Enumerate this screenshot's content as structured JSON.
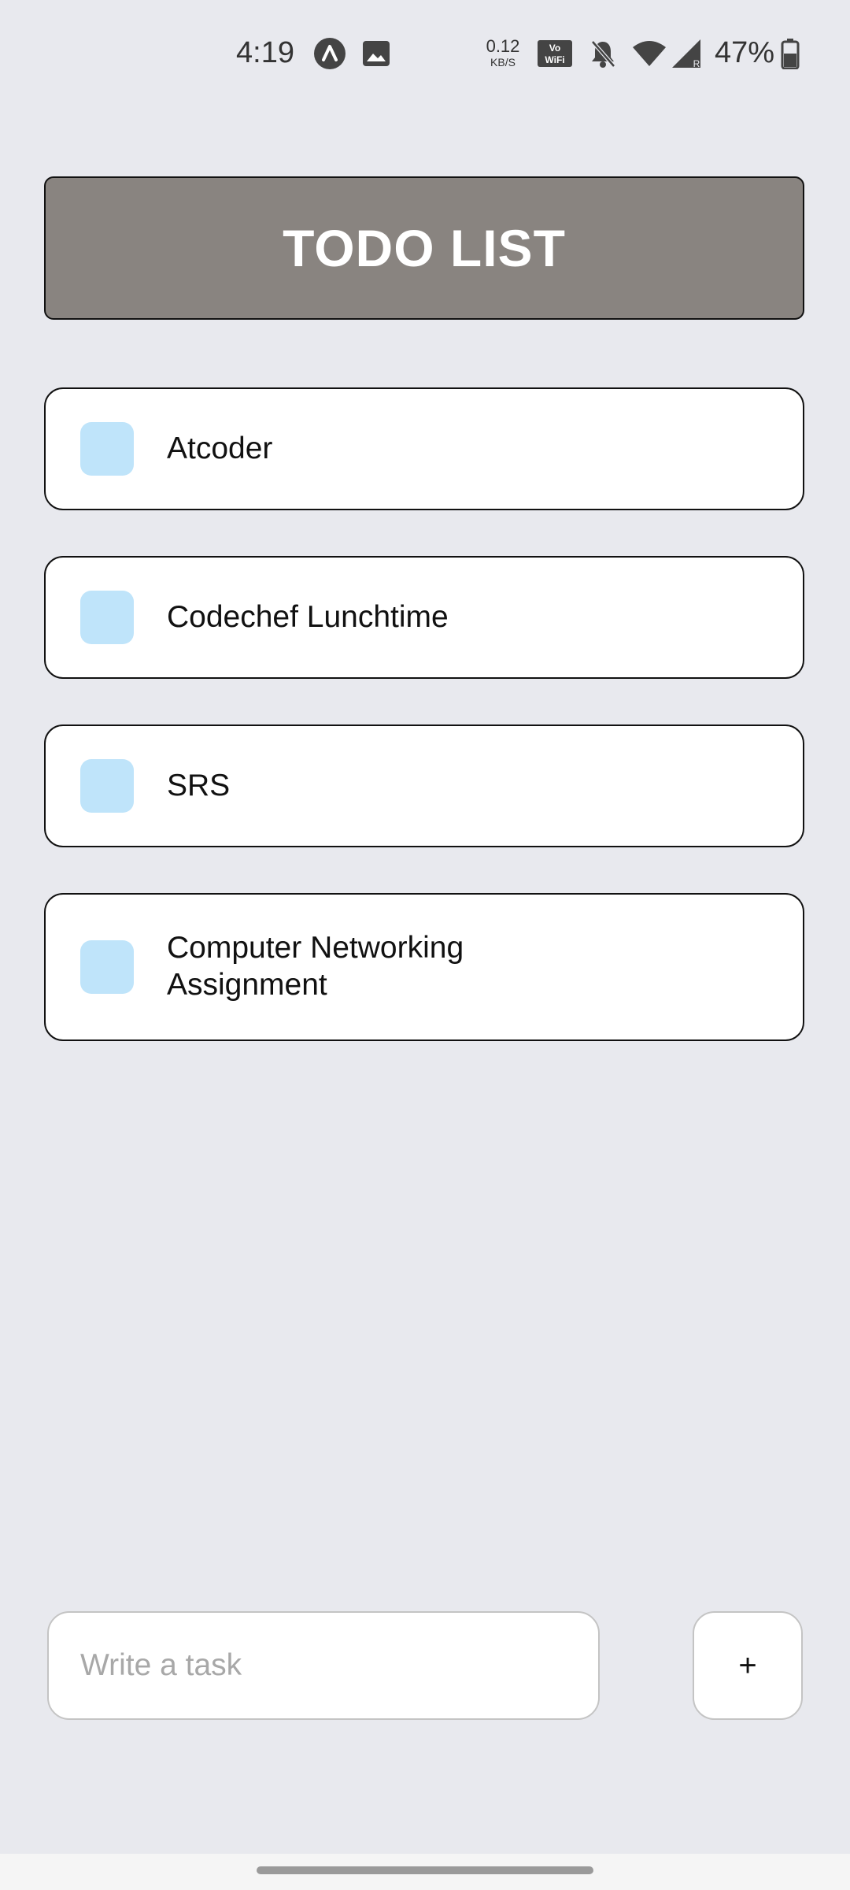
{
  "status_bar": {
    "time": "4:19",
    "net_speed_value": "0.12",
    "net_speed_unit": "KB/S",
    "battery_percent": "47%",
    "icons": [
      "app-notification-icon",
      "image-notification-icon",
      "vowifi-icon",
      "bell-muted-icon",
      "wifi-icon",
      "signal-icon",
      "battery-icon"
    ]
  },
  "header": {
    "title": "TODO LIST",
    "background_color": "#898480"
  },
  "tasks": [
    {
      "label": "Atcoder"
    },
    {
      "label": "Codechef Lunchtime"
    },
    {
      "label": "SRS"
    },
    {
      "label": "Computer Networking Assignment"
    }
  ],
  "checkbox_color": "#bfe4fa",
  "input": {
    "placeholder": "Write a task",
    "value": ""
  },
  "add_button": {
    "label": "+"
  }
}
